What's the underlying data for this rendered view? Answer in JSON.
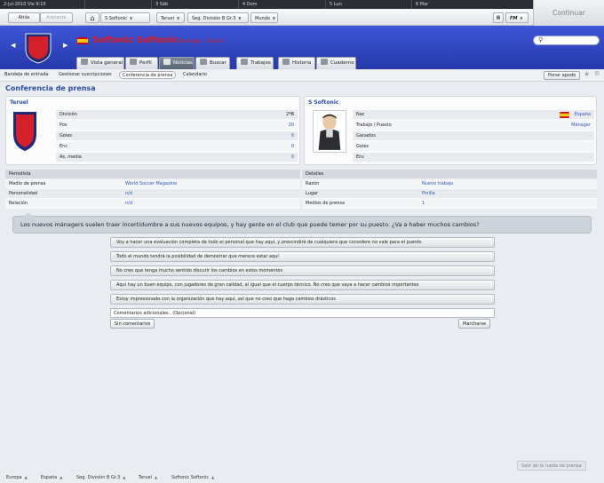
{
  "topstrip": {
    "dates": [
      {
        "label": "2-jul-2010  Vie  9:15"
      },
      {
        "label": ""
      },
      {
        "label": "3  Sáb"
      },
      {
        "label": "4  Dom"
      },
      {
        "label": "5  Lun"
      },
      {
        "label": "6  Mar"
      }
    ]
  },
  "continue_label": "Continuar",
  "navbar": {
    "back": "Atrás",
    "forward": "Adelante",
    "home_club": "S Softonic",
    "team": "Teruel",
    "league": "Seg. División B Gr.3",
    "world": "Mundo",
    "fm": "FM"
  },
  "header": {
    "name": "Softonic Softonic",
    "role": "Mánager - Teruel"
  },
  "tabs": [
    {
      "label": "Vista general"
    },
    {
      "label": "Perfil"
    },
    {
      "label": "Noticias"
    },
    {
      "label": "Buscar"
    },
    {
      "label": "Trabajos"
    },
    {
      "label": "Historia"
    },
    {
      "label": "Cuaderno"
    }
  ],
  "subnav": [
    {
      "label": "Bandeja de entrada"
    },
    {
      "label": "Gestionar suscripciones"
    },
    {
      "label": "Conferencia de prensa"
    },
    {
      "label": "Calendario"
    }
  ],
  "poner_apodo": "Poner apodo",
  "page_title": "Conferencia de prensa",
  "club_panel": {
    "title": "Teruel",
    "rows": [
      {
        "label": "División",
        "value": "2ªB"
      },
      {
        "label": "Pos",
        "value": "20"
      },
      {
        "label": "Goles",
        "value": "0"
      },
      {
        "label": "Enc",
        "value": "0"
      },
      {
        "label": "As. media",
        "value": "0"
      }
    ]
  },
  "manager_panel": {
    "title": "S Softonic",
    "rows": [
      {
        "label": "Nac",
        "value": "España"
      },
      {
        "label": "Trabajo / Puesto",
        "value": "Mánager"
      },
      {
        "label": "Ganados",
        "value": "-"
      },
      {
        "label": "Goles",
        "value": "-"
      },
      {
        "label": "Enc",
        "value": "-"
      }
    ]
  },
  "journalist": {
    "header": "Periodista",
    "rows": [
      {
        "label": "Medio de prensa",
        "value": "World Soccer Magazine"
      },
      {
        "label": "Personalidad",
        "value": "n/d"
      },
      {
        "label": "Relación",
        "value": "n/d"
      }
    ]
  },
  "details": {
    "header": "Detalles",
    "rows": [
      {
        "label": "Razón",
        "value": "Nuevo trabajo"
      },
      {
        "label": "Lugar",
        "value": "Pinilla"
      },
      {
        "label": "Medios de prensa",
        "value": "1"
      }
    ]
  },
  "question": "Los nuevos mánagers suelen traer incertidumbre a sus nuevos equipos, y hay gente en el club que puede temer por su puesto. ¿Va a haber muchos cambios?",
  "options": [
    "Voy a hacer una evaluación completa de todo el personal que hay aquí, y prescindiré de cualquiera que considere no vale para el puesto",
    "Todo el mundo tendrá la posibilidad de demostrar que merece estar aquí",
    "No creo que tenga mucho sentido discutir los cambios en estos momentos",
    "Aquí hay un buen equipo, con jugadores de gran calidad, al igual que el cuerpo técnico. No creo que vaya a hacer cambios importantes",
    "Estoy impresionado con la organización que hay aquí, así que no creo que haga cambios drásticos"
  ],
  "comment_placeholder": "Comentarios adicionales.. (Opcional)",
  "no_comment": "Sin comentarios",
  "leave": "Marcharse",
  "exit_conference": "Salir de la rueda de prensa",
  "breadcrumbs": [
    "Europa",
    "España",
    "Seg. División B Gr.3",
    "Teruel",
    "Softonic Softonic"
  ],
  "colors": {
    "header_blue": "#2f45c4",
    "accent_link": "#2c56b8",
    "club_red": "#d4202a"
  }
}
